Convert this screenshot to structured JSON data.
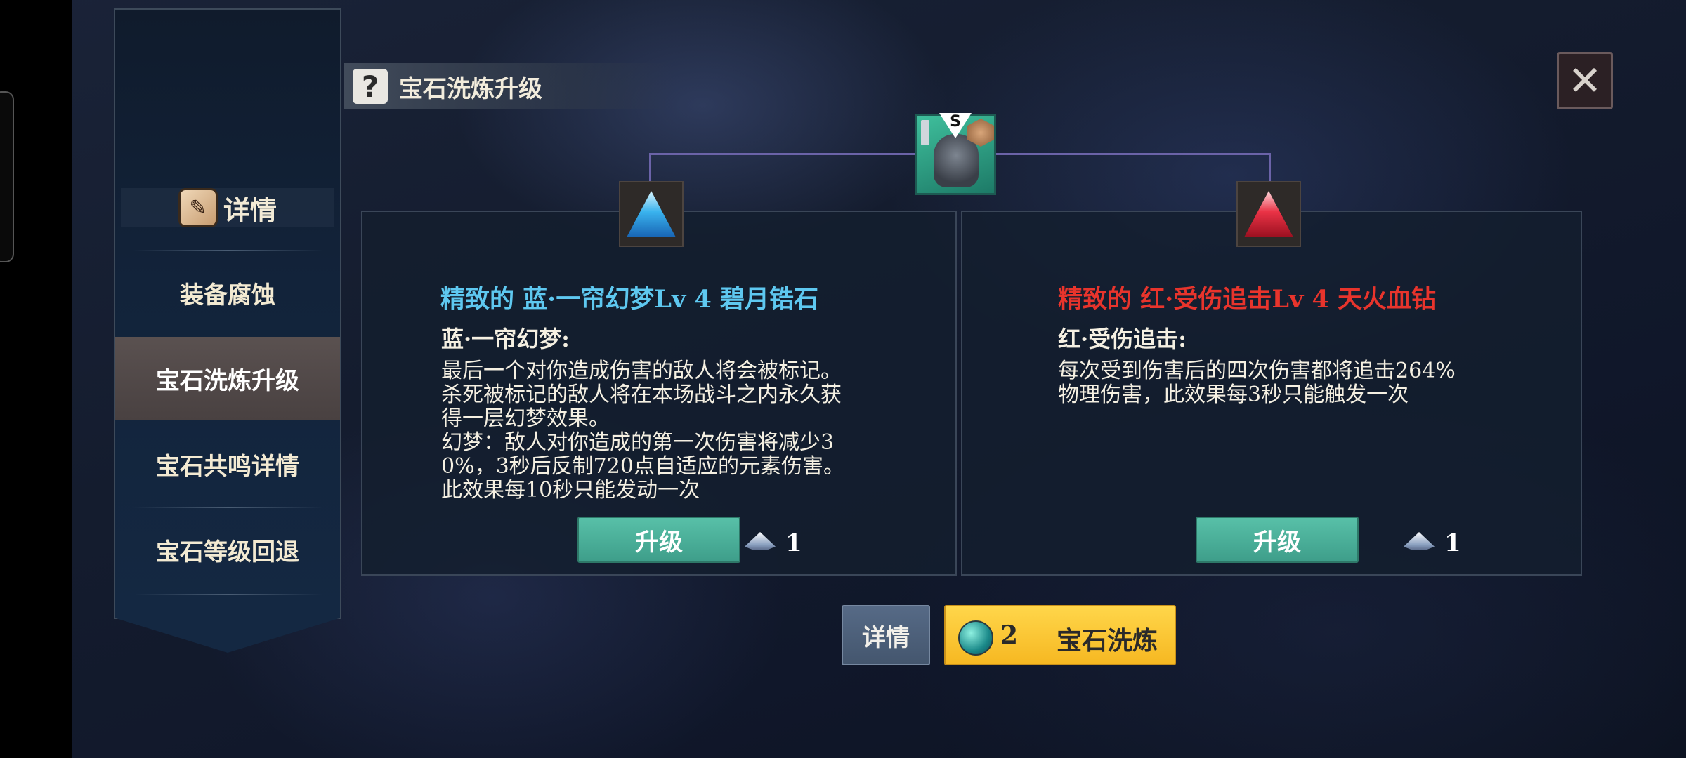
{
  "page": {
    "title": "宝石洗炼升级"
  },
  "sidebar": {
    "header": {
      "icon": "scroll-quill-icon",
      "label": "详情"
    },
    "items": [
      {
        "label": "装备腐蚀",
        "active": false
      },
      {
        "label": "宝石洗炼升级",
        "active": true
      },
      {
        "label": "宝石共鸣详情",
        "active": false
      },
      {
        "label": "宝石等级回退",
        "active": false
      }
    ]
  },
  "equipment": {
    "icon": "armor-chestplate-icon",
    "grade": "S"
  },
  "gems": {
    "blue": {
      "name": "精致的 蓝·一帘幻梦Lv 4 碧月锆石",
      "name_color": "#5ec8f0",
      "effect_label": "蓝·一帘幻梦:",
      "effect_text": "最后一个对你造成伤害的敌人将会被标记。杀死被标记的敌人将在本场战斗之内永久获得一层幻梦效果。\n幻梦：敌人对你造成的第一次伤害将减少30%，3秒后反制720点自适应的元素伤害。此效果每10秒只能发动一次",
      "upgrade_label": "升级",
      "cost": "1"
    },
    "red": {
      "name": "精致的 红·受伤追击Lv 4 天火血钻",
      "name_color": "#e8342c",
      "effect_label": "红·受伤追击:",
      "effect_text": "每次受到伤害后的四次伤害都将追击264%物理伤害，此效果每3秒只能触发一次",
      "upgrade_label": "升级",
      "cost": "1"
    }
  },
  "actions": {
    "details_label": "详情",
    "refine_cost": "2",
    "refine_label": "宝石洗炼"
  },
  "colors": {
    "accent_gold": "#f6c22e",
    "upgrade_green": "#4cb09a",
    "active_tab": "#514848"
  }
}
